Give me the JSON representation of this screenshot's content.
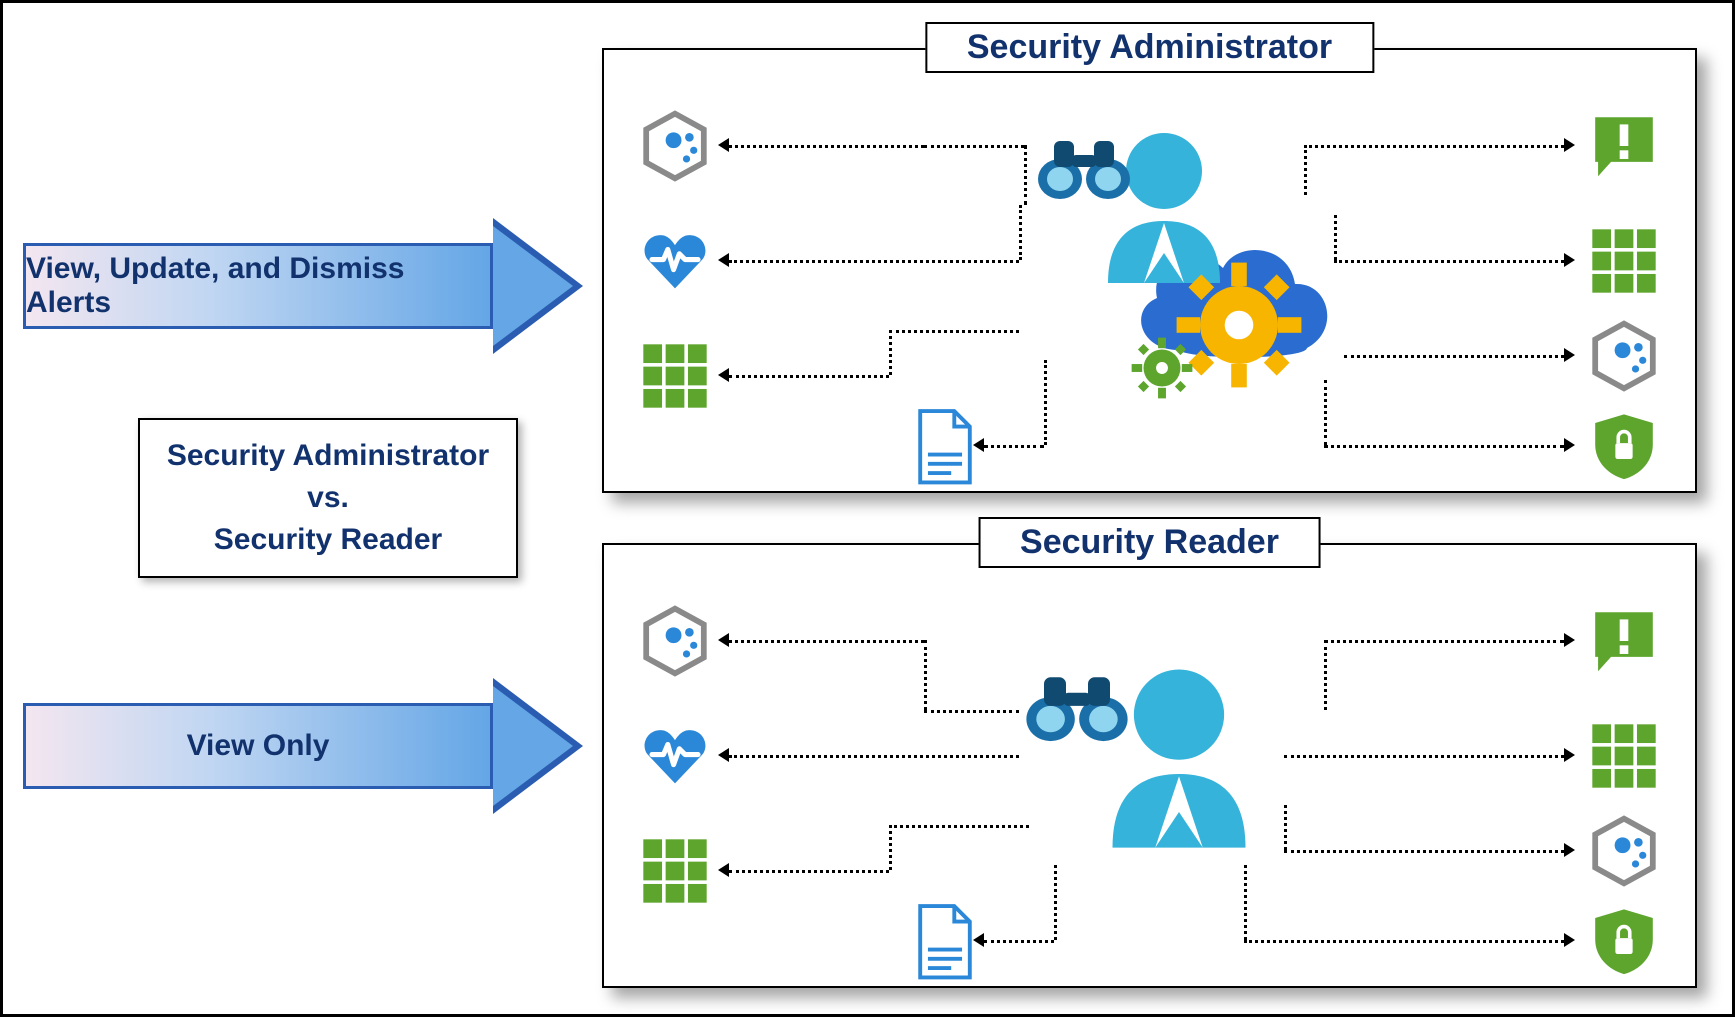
{
  "arrows": {
    "admin_label": "View, Update, and Dismiss Alerts",
    "reader_label": "View Only"
  },
  "compare": {
    "line1": "Security Administrator",
    "line2": "vs.",
    "line3": "Security Reader"
  },
  "panels": {
    "admin_title": "Security Administrator",
    "reader_title": "Security Reader"
  },
  "icons": {
    "hex_dots": "hexagon-dots-icon",
    "heart_pulse": "heart-pulse-icon",
    "grid_green": "grid-icon",
    "alert_green": "alert-icon",
    "shield_lock": "shield-lock-icon",
    "document": "document-icon",
    "user": "user-icon",
    "binoculars": "binoculars-icon",
    "cloud": "cloud-icon",
    "gear_large": "gear-large-icon",
    "gear_small": "gear-small-icon"
  },
  "colors": {
    "navy": "#12326e",
    "blue": "#2a5db1",
    "azure": "#2b88d8",
    "green": "#5ea52e",
    "orange": "#f7b500"
  }
}
